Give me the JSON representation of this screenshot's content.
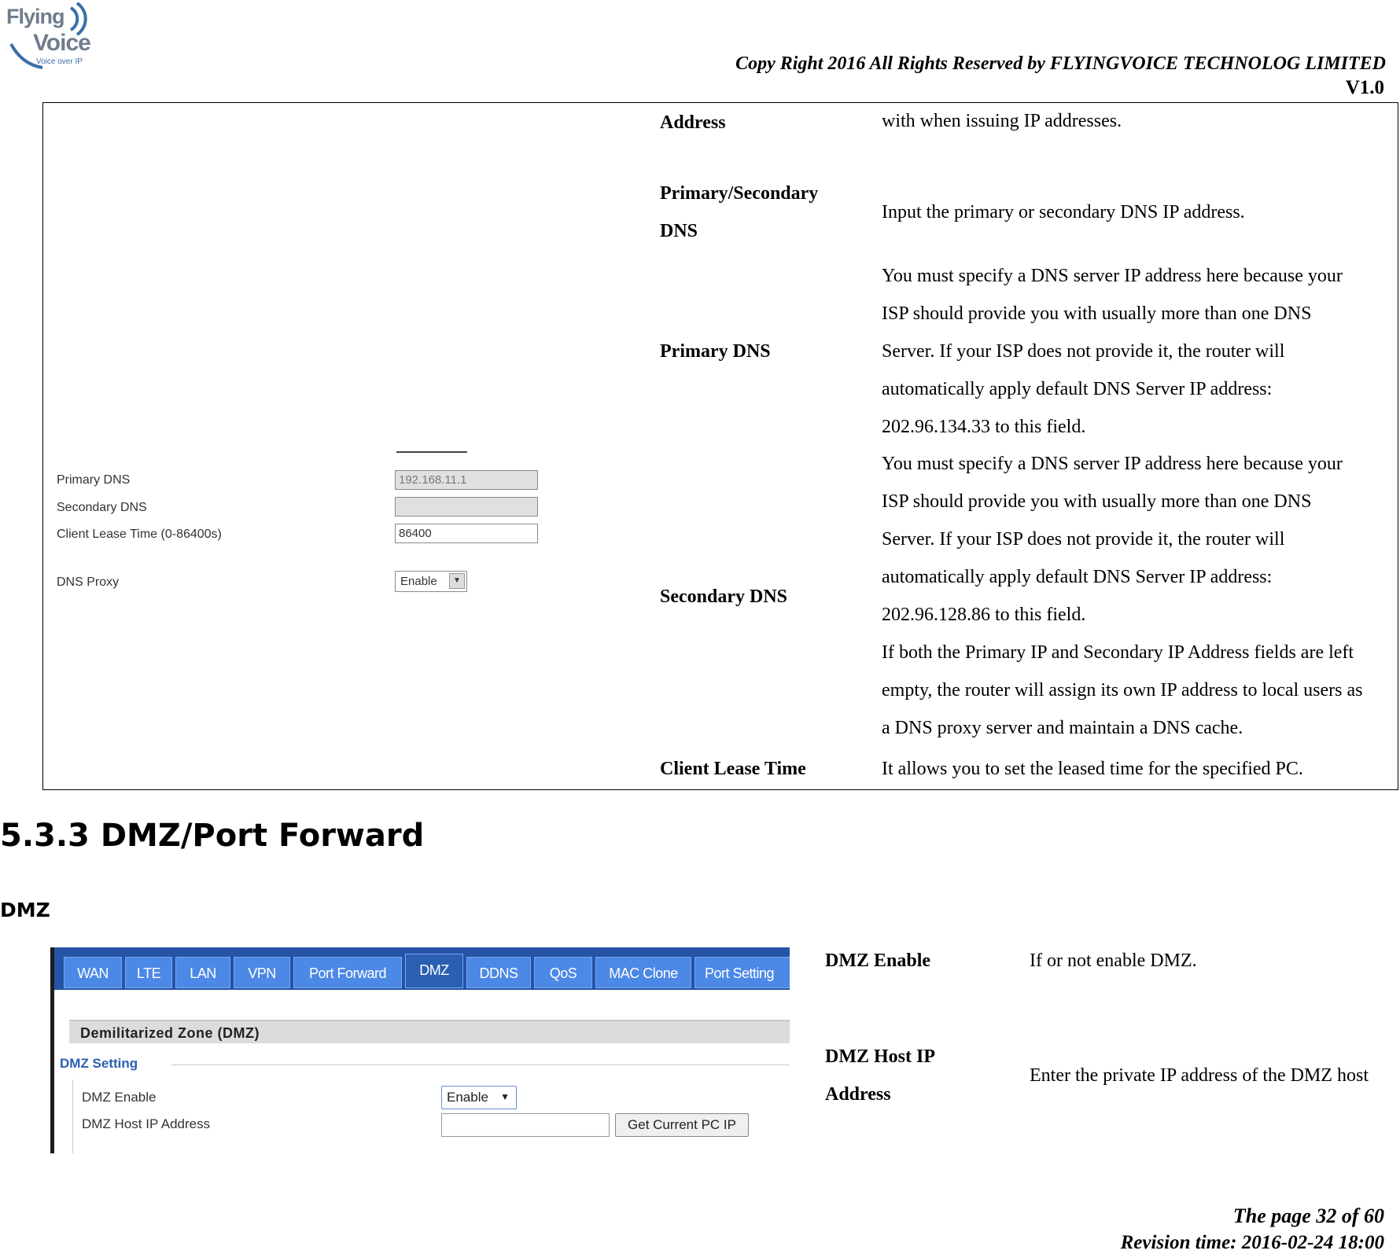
{
  "header": {
    "logo": {
      "line1": "Flying",
      "line2": "Voice",
      "tagline": "Voice over IP"
    },
    "copyright": "Copy Right 2016 All Rights Reserved by FLYINGVOICE TECHNOLOG LIMITED",
    "version": "V1.0"
  },
  "table1": {
    "screenshot": {
      "rows": [
        {
          "label": "Primary DNS",
          "value": "192.168.11.1"
        },
        {
          "label": "Secondary DNS",
          "value": ""
        },
        {
          "label": "Client Lease Time (0-86400s)",
          "value": "86400"
        },
        {
          "label": "DNS Proxy",
          "value": "Enable"
        }
      ]
    },
    "rows": [
      {
        "label": [
          "Address"
        ],
        "desc": [
          "with when issuing IP addresses."
        ]
      },
      {
        "label": [
          "Primary/Secondary",
          "DNS"
        ],
        "desc": [
          "Input the primary or secondary DNS IP address."
        ]
      },
      {
        "label": [
          "Primary DNS"
        ],
        "desc": [
          "You must specify a DNS server IP address here because your",
          "ISP should provide you with usually more than one DNS",
          "Server. If your ISP does not provide it, the router will",
          "automatically apply default DNS Server IP address:",
          "202.96.134.33 to this field."
        ]
      },
      {
        "label": [
          "Secondary DNS"
        ],
        "desc": [
          "You must specify a DNS server IP address here because your",
          "ISP should provide you with usually more than one DNS",
          "Server. If your ISP does not provide it, the router will",
          "automatically apply default DNS Server IP address:",
          "202.96.128.86 to this field.",
          "If both the Primary IP and Secondary IP Address fields are left",
          "empty, the router will assign its own IP address to local users as",
          "a DNS proxy server and maintain a DNS cache."
        ]
      },
      {
        "label": [
          "Client Lease Time"
        ],
        "desc": [
          "It allows you to set the leased time for the specified PC."
        ]
      }
    ]
  },
  "section": {
    "heading": "5.3.3 DMZ/Port Forward",
    "subheading": "DMZ"
  },
  "dmz_screenshot": {
    "tabs": [
      "WAN",
      "LTE",
      "LAN",
      "VPN",
      "Port Forward",
      "DMZ",
      "DDNS",
      "QoS",
      "MAC Clone",
      "Port Setting"
    ],
    "active_tab": "DMZ",
    "banner": "Demilitarized Zone (DMZ)",
    "setting_title": "DMZ Setting",
    "enable_label": "DMZ Enable",
    "enable_value": "Enable",
    "host_label": "DMZ Host IP Address",
    "host_value": "",
    "button": "Get Current PC IP"
  },
  "table2": {
    "rows": [
      {
        "label": [
          "DMZ Enable"
        ],
        "desc": [
          "If or not enable DMZ."
        ]
      },
      {
        "label": [
          "DMZ Host IP",
          "Address"
        ],
        "desc": [
          "Enter the private IP address of the DMZ host"
        ]
      }
    ]
  },
  "footer": {
    "page": "The page 32 of 60",
    "revision": "Revision time: 2016-02-24 18:00"
  }
}
